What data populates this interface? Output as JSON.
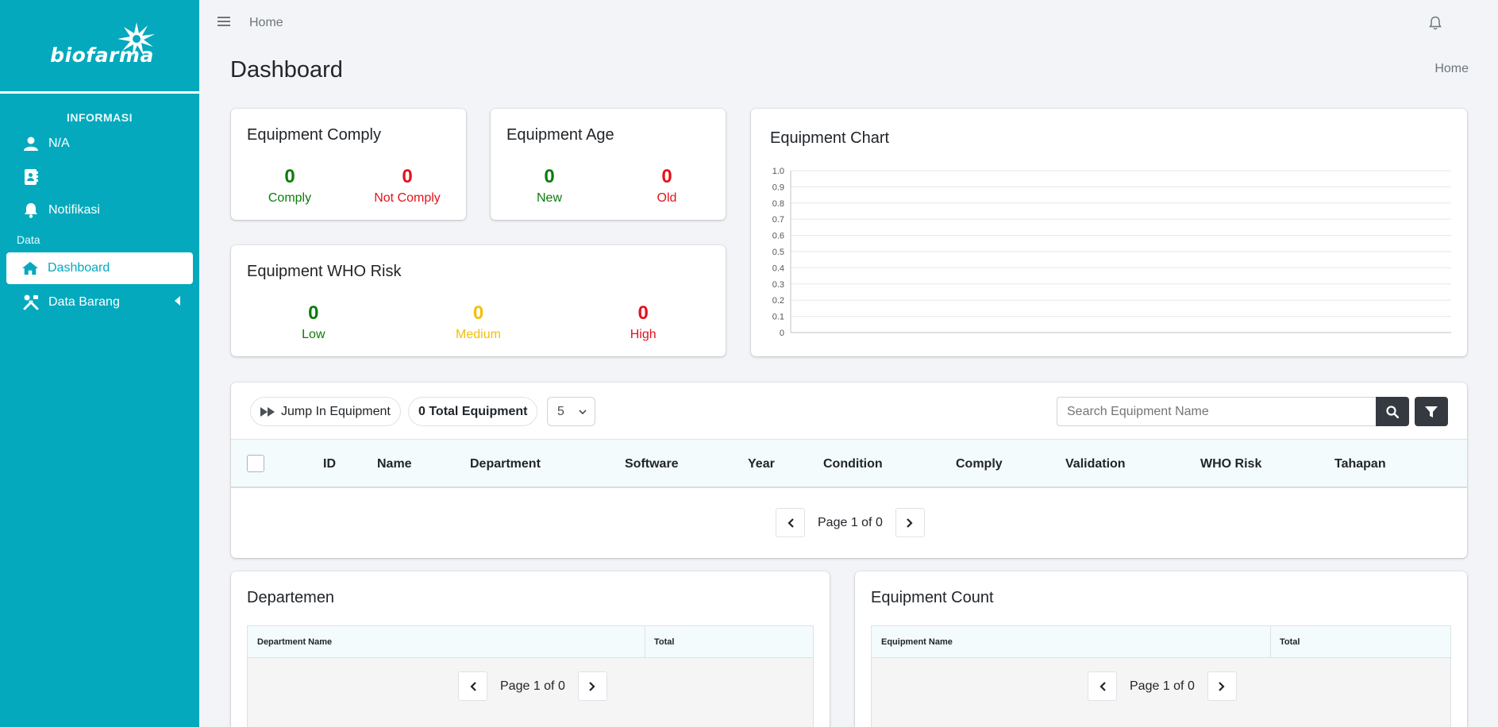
{
  "sidebar": {
    "logo_text": "biofarma",
    "section_title": "INFORMASI",
    "user_name": "N/A",
    "notif_label": "Notifikasi",
    "group_label": "Data",
    "dashboard_label": "Dashboard",
    "data_barang_label": "Data Barang"
  },
  "topbar": {
    "home_link": "Home"
  },
  "page": {
    "title": "Dashboard",
    "breadcrumb": "Home"
  },
  "comply": {
    "title": "Equipment Comply",
    "comply_value": "0",
    "comply_label": "Comply",
    "not_value": "0",
    "not_label": "Not Comply"
  },
  "age": {
    "title": "Equipment Age",
    "new_value": "0",
    "new_label": "New",
    "old_value": "0",
    "old_label": "Old"
  },
  "risk": {
    "title": "Equipment WHO Risk",
    "low_value": "0",
    "low_label": "Low",
    "medium_value": "0",
    "medium_label": "Medium",
    "high_value": "0",
    "high_label": "High"
  },
  "chart_card": {
    "title": "Equipment Chart"
  },
  "chart_data": {
    "type": "bar",
    "categories": [],
    "values": [],
    "title": "Equipment Chart",
    "ylim": [
      0,
      1.0
    ],
    "yticks": [
      "0",
      "0.1",
      "0.2",
      "0.3",
      "0.4",
      "0.5",
      "0.6",
      "0.7",
      "0.8",
      "0.9",
      "1.0"
    ],
    "grid": true
  },
  "equipment": {
    "jump_label": "Jump In Equipment",
    "total_label": "0 Total Equipment",
    "page_size": "5",
    "search_placeholder": "Search Equipment Name",
    "columns": [
      "ID",
      "Name",
      "Department",
      "Software",
      "Year",
      "Condition",
      "Comply",
      "Validation",
      "WHO Risk",
      "Tahapan"
    ],
    "page_text": "Page 1 of 0"
  },
  "departemen": {
    "title": "Departemen",
    "col1": "Department Name",
    "col2": "Total",
    "page_text": "Page 1 of 0"
  },
  "equip_count": {
    "title": "Equipment Count",
    "col1": "Equipment Name",
    "col2": "Total",
    "page_text": "Page 1 of 0"
  },
  "colors": {
    "sidebar": "#04a9bd",
    "green": "#0a7d0a",
    "red": "#e3121b",
    "yellow": "#f0c10c"
  }
}
